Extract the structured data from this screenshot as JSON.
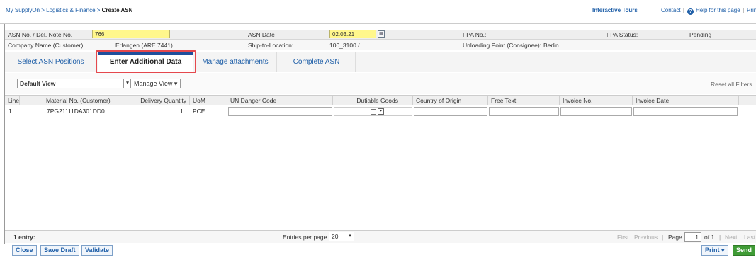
{
  "breadcrumb": {
    "home": "My SupplyOn",
    "section": "Logistics & Finance",
    "current": "Create ASN"
  },
  "topright": {
    "tours": "Interactive Tours",
    "contact": "Contact",
    "help": "Help for this page",
    "print": "Prin"
  },
  "header": {
    "asn_label": "ASN No. / Del. Note No.",
    "asn_value": "766",
    "asn_date_label": "ASN Date",
    "asn_date_value": "02.03.21",
    "fpa_no_label": "FPA No.:",
    "fpa_status_label": "FPA Status:",
    "fpa_status_value": "Pending",
    "company_label": "Company Name (Customer):",
    "company_value": "Erlangen (ARE 7441)",
    "ship_label": "Ship-to-Location:",
    "ship_value": "100_3100 /",
    "unloading_label": "Unloading Point (Consignee):",
    "unloading_value": "Berlin"
  },
  "tabs": [
    "Select ASN Positions",
    "Enter Additional Data",
    "Manage attachments",
    "Complete ASN"
  ],
  "toolbar": {
    "view": "Default View",
    "manage_view": "Manage View",
    "reset": "Reset all Filters"
  },
  "columns": [
    "Line",
    "Material No. (Customer)",
    "Delivery Quantity",
    "UoM",
    "UN Danger Code",
    "Dutiable Goods",
    "Country of Origin",
    "Free Text",
    "Invoice No.",
    "Invoice Date"
  ],
  "row": {
    "line": "1",
    "material": "7PG21111DA301DD0",
    "qty": "1",
    "uom": "PCE"
  },
  "footer": {
    "entries": "1 entry:",
    "per_page_label": "Entries per page",
    "per_page": "20",
    "first": "First",
    "previous": "Previous",
    "page_label": "Page",
    "page": "1",
    "of": "of 1",
    "next": "Next",
    "last": "Last"
  },
  "buttons": {
    "close": "Close",
    "save_draft": "Save Draft",
    "validate": "Validate",
    "print": "Print",
    "send": "Send"
  },
  "colors": {
    "link": "#1f5fa8",
    "highlight": "#fff78c",
    "tab_outline": "#e5484d",
    "send": "#3f9b35"
  }
}
